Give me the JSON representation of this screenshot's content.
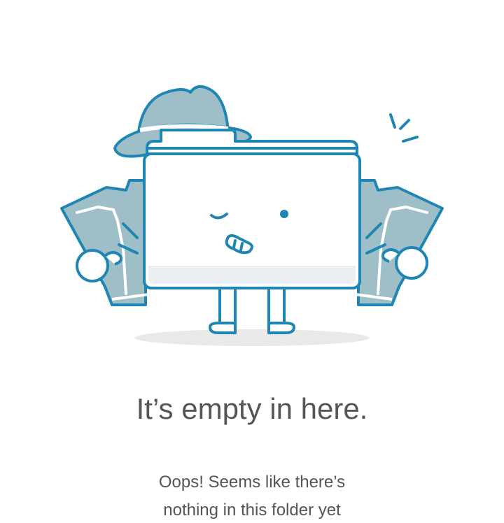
{
  "empty_state": {
    "title": "It’s empty in here.",
    "message_line1": "Oops! Seems like there’s",
    "message_line2": "nothing in this folder yet",
    "illustration": "folder-detective-icon"
  },
  "colors": {
    "outline": "#1f86b3",
    "coat_fill": "#9ebfc8",
    "folder_fill": "#ffffff",
    "folder_shadow": "#e8eef2",
    "ground_shadow": "#e9e9e9",
    "text": "#555555"
  }
}
